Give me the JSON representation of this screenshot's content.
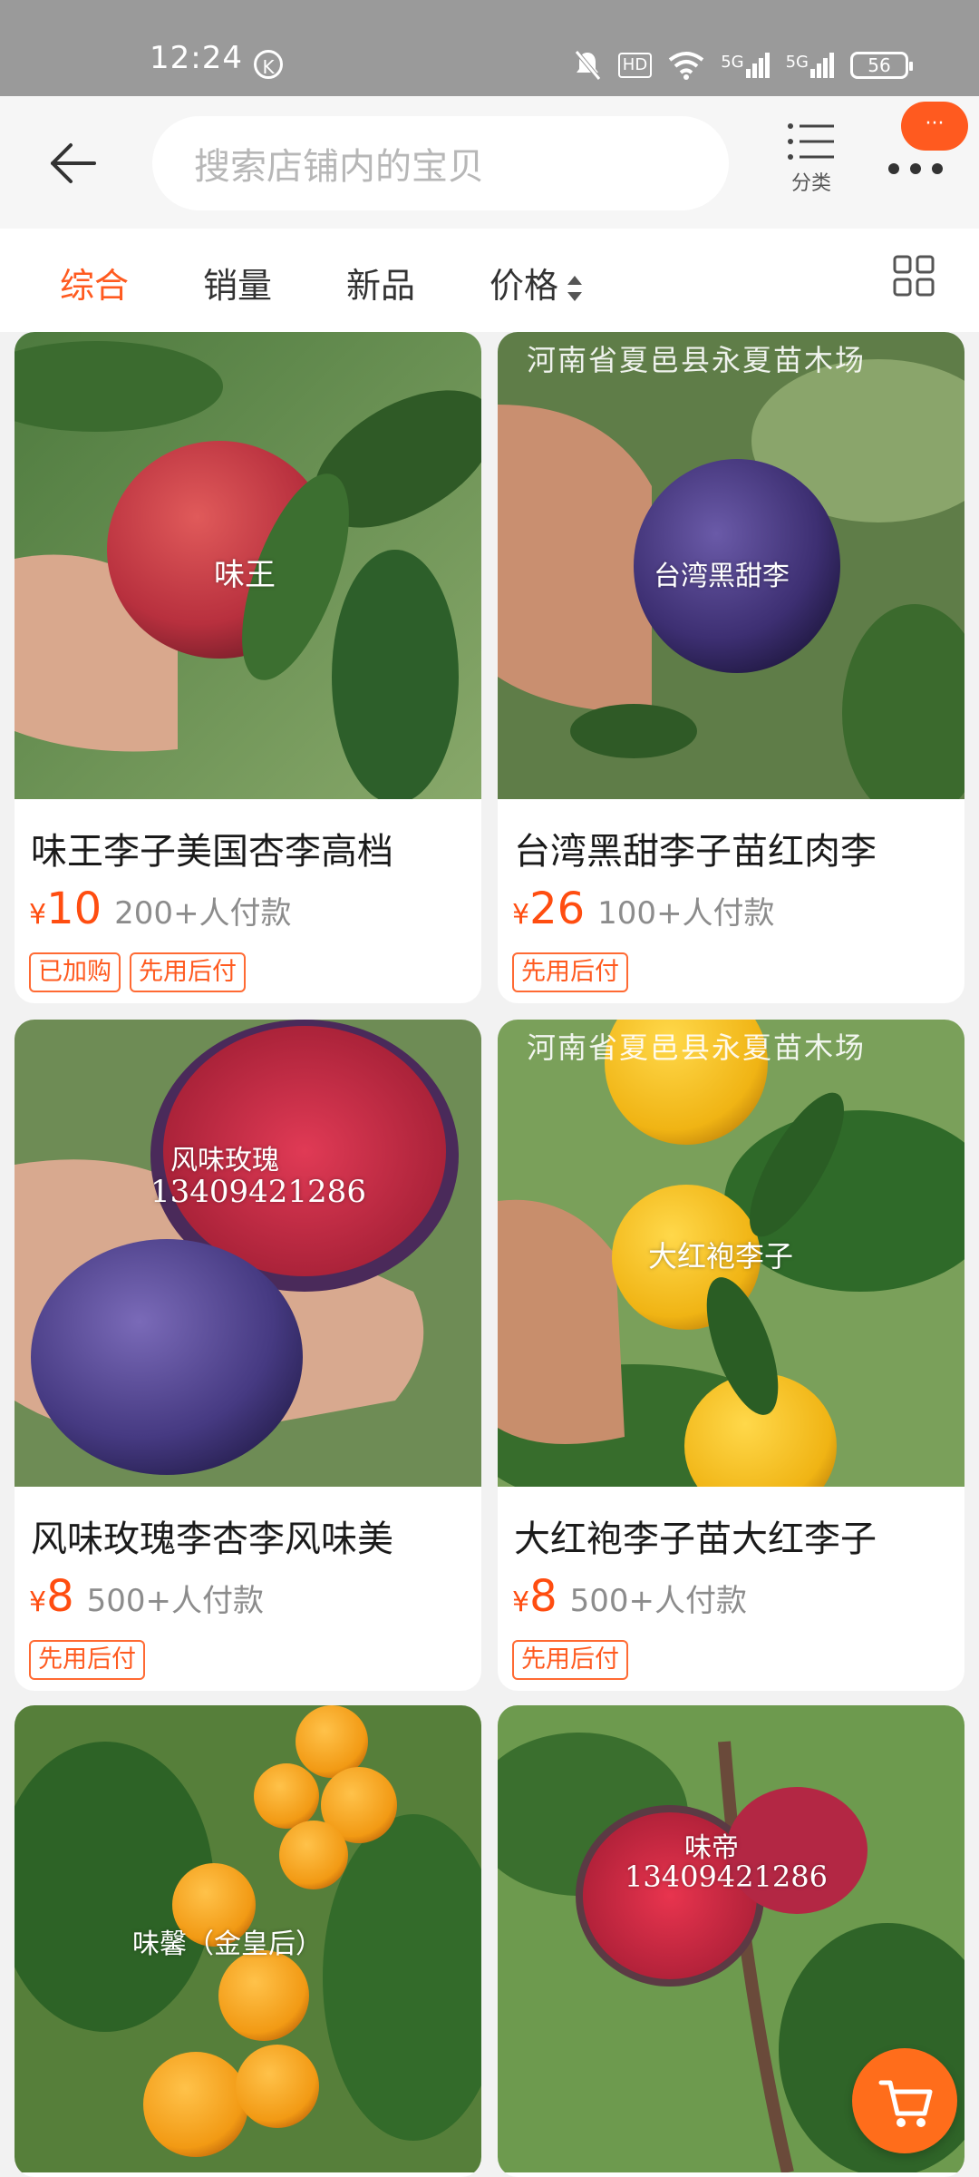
{
  "status_bar": {
    "time": "12:24",
    "k_icon": "K",
    "hd": "HD",
    "net1": "5G",
    "net2": "5G",
    "battery": "56"
  },
  "search": {
    "placeholder": "搜索店铺内的宝贝"
  },
  "header": {
    "category_label": "分类",
    "badge": "···"
  },
  "tabs": [
    "综合",
    "销量",
    "新品",
    "价格"
  ],
  "colors": {
    "accent": "#ff5a1f",
    "tag_border": "#ff6a33"
  },
  "products": [
    {
      "title": "味王李子美国杏李高档",
      "price_symbol": "¥",
      "price": "10",
      "sales": "200+人付款",
      "tags": [
        "已加购",
        "先用后付"
      ],
      "image_text": "味王",
      "watermark": ""
    },
    {
      "title": "台湾黑甜李子苗红肉李",
      "price_symbol": "¥",
      "price": "26",
      "sales": "100+人付款",
      "tags": [
        "先用后付"
      ],
      "image_text": "台湾黑甜李",
      "watermark": "河南省夏邑县永夏苗木场"
    },
    {
      "title": "风味玫瑰李杏李风味美",
      "price_symbol": "¥",
      "price": "8",
      "sales": "500+人付款",
      "tags": [
        "先用后付"
      ],
      "image_text": "风味玫瑰",
      "image_text2": "13409421286",
      "watermark": ""
    },
    {
      "title": "大红袍李子苗大红李子",
      "price_symbol": "¥",
      "price": "8",
      "sales": "500+人付款",
      "tags": [
        "先用后付"
      ],
      "image_text": "大红袍李子",
      "watermark": "河南省夏邑县永夏苗木场"
    },
    {
      "title": "",
      "image_text": "味馨（金皇后）"
    },
    {
      "title": "",
      "image_text": "味帝",
      "image_text2": "13409421286"
    }
  ]
}
